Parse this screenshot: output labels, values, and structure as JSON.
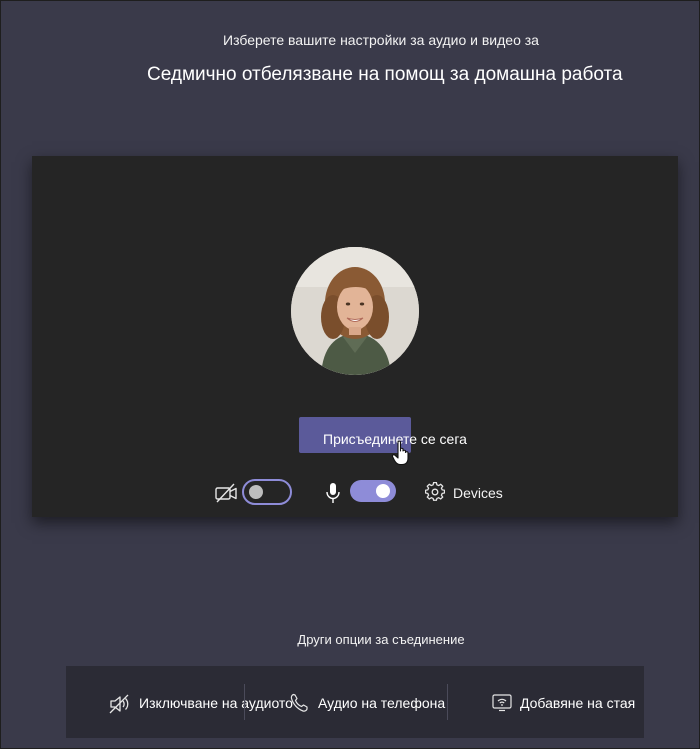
{
  "header": {
    "subtitle": "Изберете вашите настройки за аудио и видео за",
    "meeting_title": "Седмично отбелязване на помощ за домашна работа"
  },
  "preview": {
    "join_button_label": "Присъединете се сега",
    "camera_toggle": {
      "state": "off",
      "icon": "camera-off-icon"
    },
    "microphone_toggle": {
      "state": "on",
      "icon": "microphone-icon"
    },
    "devices_label": "Devices",
    "devices_icon": "gear-icon"
  },
  "other_options": {
    "heading": "Други опции за съединение",
    "items": [
      {
        "label": "Изключване на аудиото",
        "icon": "speaker-off-icon"
      },
      {
        "label": "Аудио на телефона",
        "icon": "phone-icon"
      },
      {
        "label": "Добавяне на стая",
        "icon": "room-cast-icon"
      }
    ]
  },
  "colors": {
    "background": "#3a3a4a",
    "preview_background": "#252525",
    "accent": "#8e8cd8",
    "join_button": "#5b5a9a",
    "options_bar": "#2b2b35"
  }
}
